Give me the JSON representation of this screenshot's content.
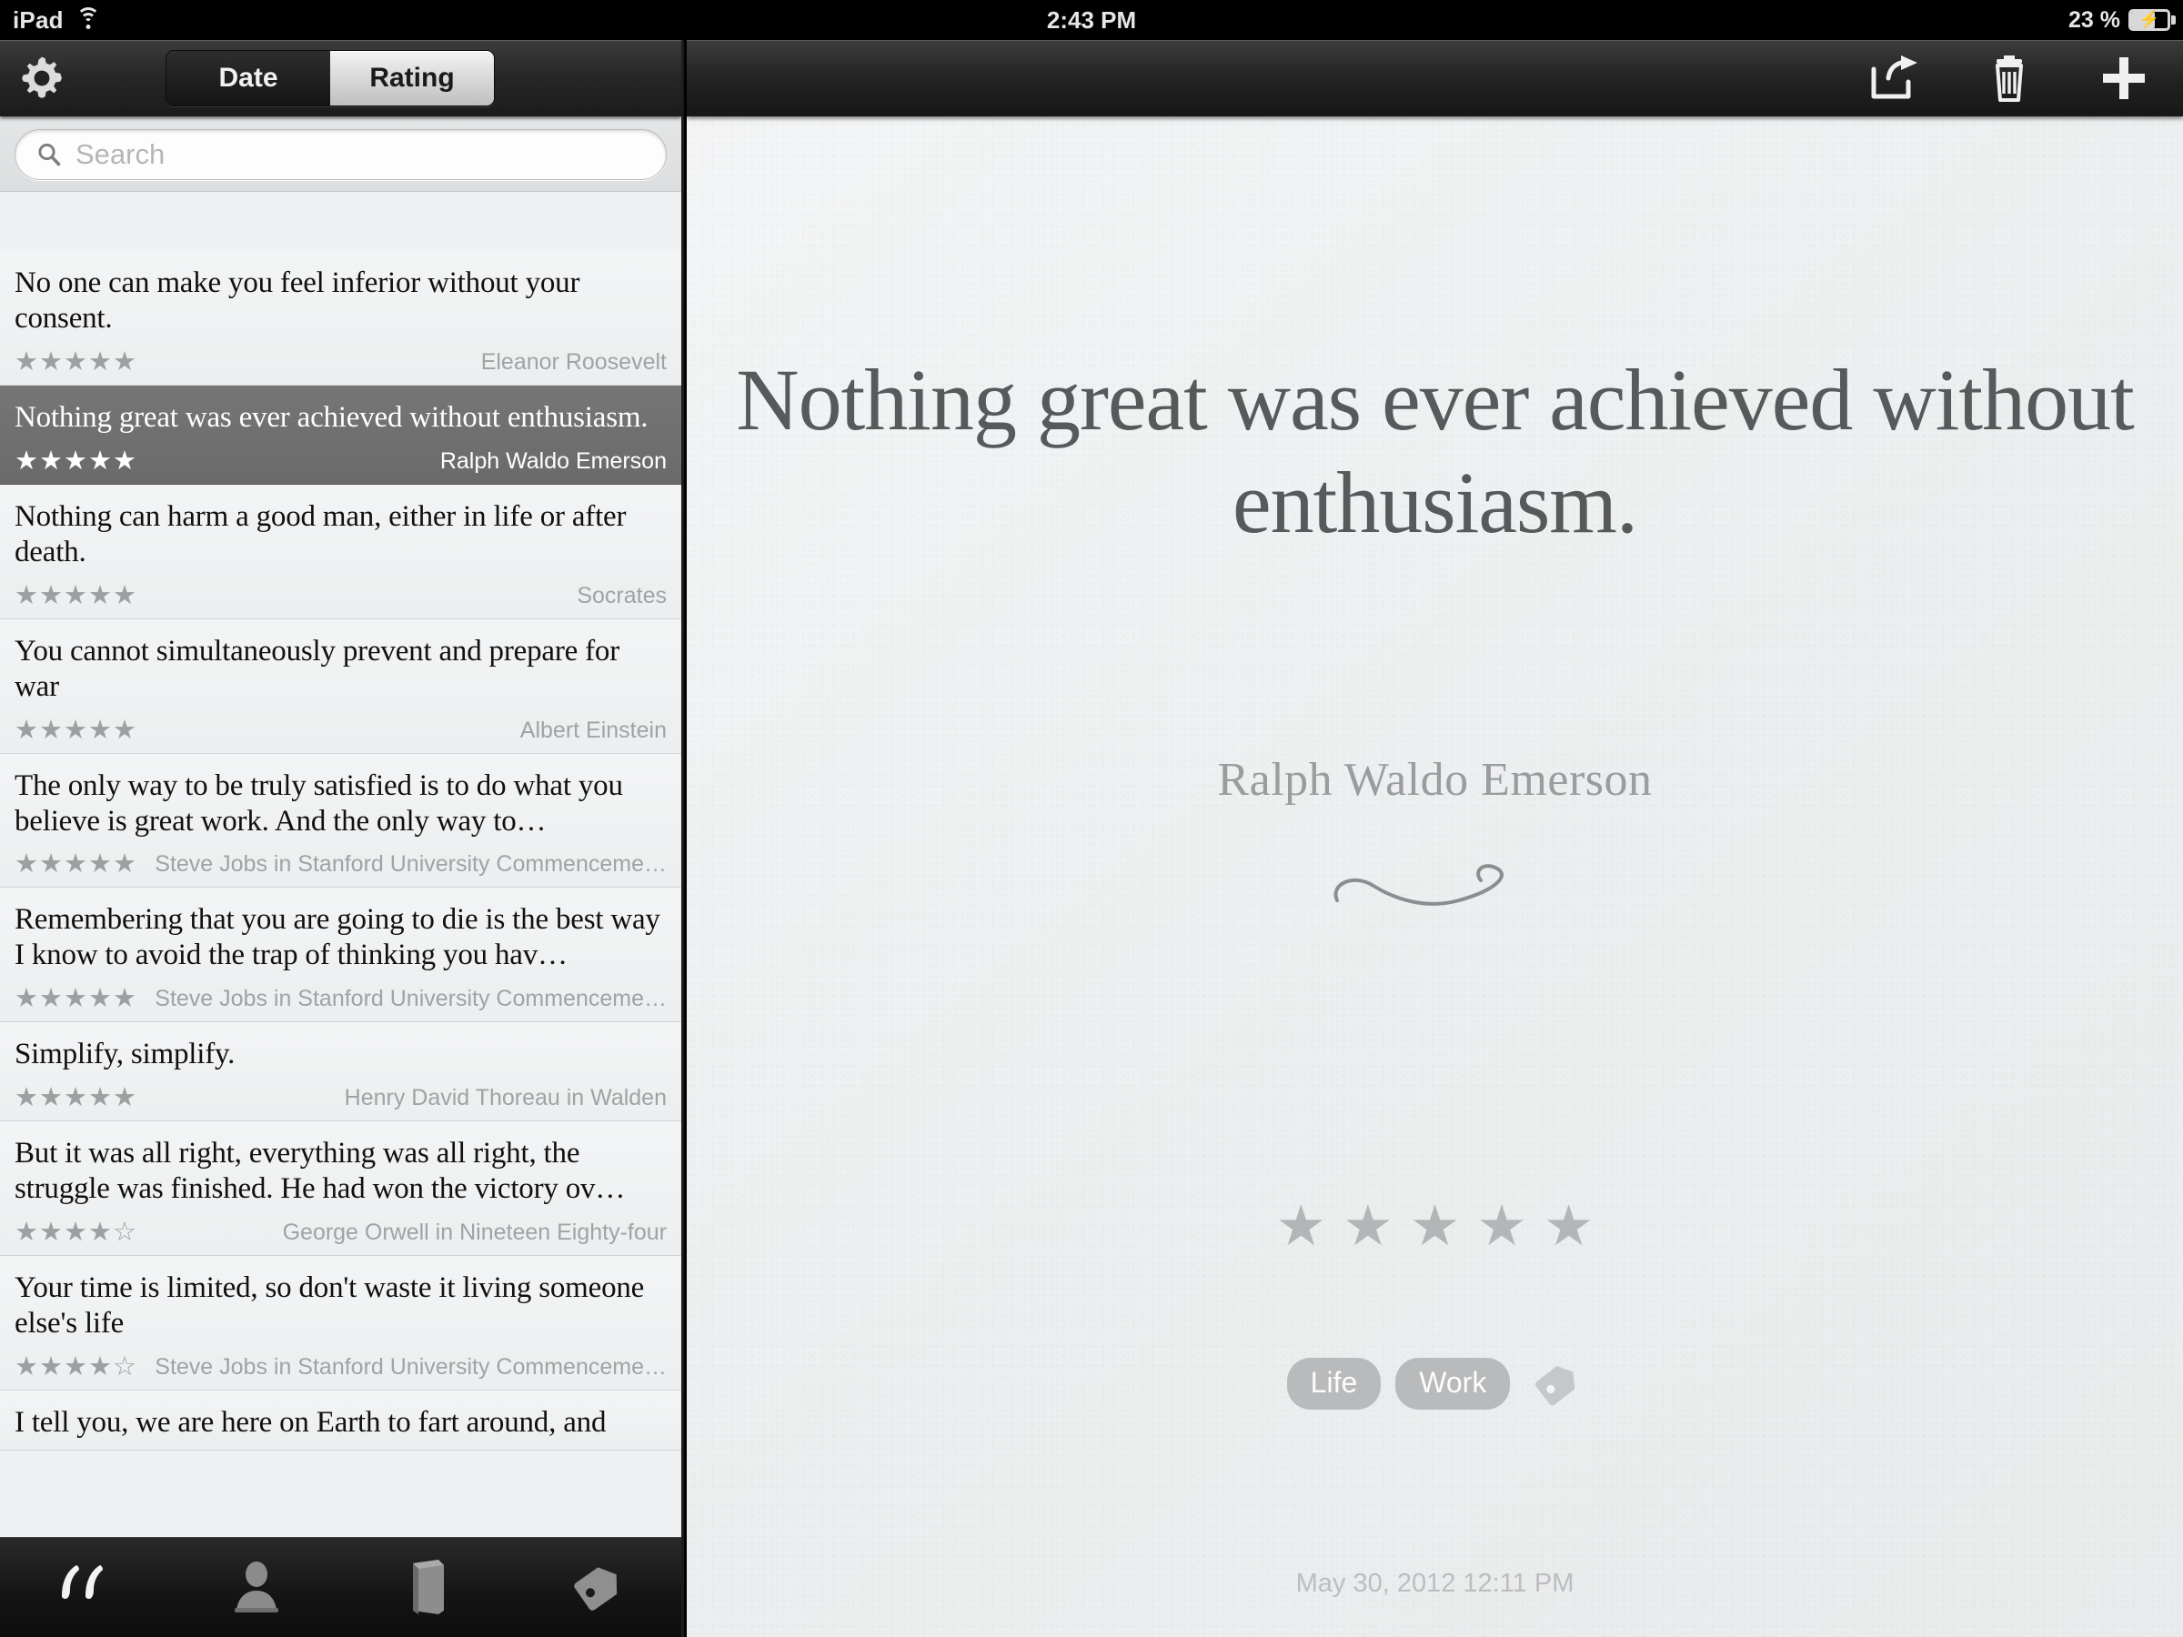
{
  "status_bar": {
    "device": "iPad",
    "wifi_icon": "wifi-icon",
    "time": "2:43 PM",
    "battery_percent": "23 %",
    "battery_icon": "battery-charging-icon"
  },
  "sidebar": {
    "settings_icon": "gear-icon",
    "sort_segments": [
      {
        "label": "Date",
        "selected": false
      },
      {
        "label": "Rating",
        "selected": true
      }
    ],
    "search": {
      "icon": "search-icon",
      "value": "",
      "placeholder": "Search"
    },
    "quotes": [
      {
        "text": "No one can make you feel inferior without your consent.",
        "stars": "★★★★★",
        "rating": 5,
        "author": "Eleanor Roosevelt",
        "selected": false
      },
      {
        "text": "Nothing great was ever achieved without enthusiasm.",
        "stars": "★★★★★",
        "rating": 5,
        "author": "Ralph Waldo Emerson",
        "selected": true
      },
      {
        "text": "Nothing can harm a good man, either in life or after death.",
        "stars": "★★★★★",
        "rating": 5,
        "author": "Socrates",
        "selected": false
      },
      {
        "text": "You cannot simultaneously prevent and prepare for war",
        "stars": "★★★★★",
        "rating": 5,
        "author": "Albert Einstein",
        "selected": false
      },
      {
        "text": "The only way to be truly satisfied is to do what you believe is great work. And the only way to…",
        "stars": "★★★★★",
        "rating": 5,
        "author": "Steve Jobs in Stanford University Commenceme…",
        "selected": false
      },
      {
        "text": "Remembering that you are going to die is the best way I know to avoid the trap of thinking you hav…",
        "stars": "★★★★★",
        "rating": 5,
        "author": "Steve Jobs in Stanford University Commenceme…",
        "selected": false
      },
      {
        "text": "Simplify, simplify.",
        "stars": "★★★★★",
        "rating": 5,
        "author": "Henry David Thoreau in Walden",
        "selected": false
      },
      {
        "text": "But it was all right, everything was all right, the struggle was finished. He had won the victory ov…",
        "stars": "★★★★☆",
        "rating": 4,
        "author": "George Orwell in Nineteen Eighty-four",
        "selected": false
      },
      {
        "text": "Your time is limited, so don't waste it living someone else's life",
        "stars": "★★★★☆",
        "rating": 4,
        "author": "Steve Jobs in Stanford University Commenceme…",
        "selected": false
      },
      {
        "text": "I tell you, we are here on Earth to fart around, and",
        "stars": "",
        "rating": 0,
        "author": "",
        "selected": false
      }
    ],
    "tabs": [
      {
        "name": "quotes",
        "icon": "quote-marks-icon",
        "active": true
      },
      {
        "name": "authors",
        "icon": "person-icon",
        "active": false
      },
      {
        "name": "books",
        "icon": "book-icon",
        "active": false
      },
      {
        "name": "tags",
        "icon": "tag-icon",
        "active": false
      }
    ]
  },
  "detail": {
    "toolbar": [
      {
        "name": "share",
        "icon": "share-icon"
      },
      {
        "name": "delete",
        "icon": "trash-icon"
      },
      {
        "name": "add",
        "icon": "plus-icon"
      }
    ],
    "quote_text": "Nothing great was ever achieved without enthusiasm.",
    "author": "Ralph Waldo Emerson",
    "ornament_icon": "flourish-ornament",
    "stars": "★★★★★",
    "rating": 5,
    "tags": [
      "Life",
      "Work"
    ],
    "add_tag_icon": "tag-icon",
    "date": "May 30, 2012 12:11 PM"
  },
  "colors": {
    "chrome_dark": "#1b1b1b",
    "paper": "#eceeef",
    "selection_gray": "#6e6e6e",
    "quote_text": "#58595b",
    "muted_text": "#a0a2a4",
    "star_gray": "#b4b5b7",
    "tag_pill": "#b9babb"
  }
}
